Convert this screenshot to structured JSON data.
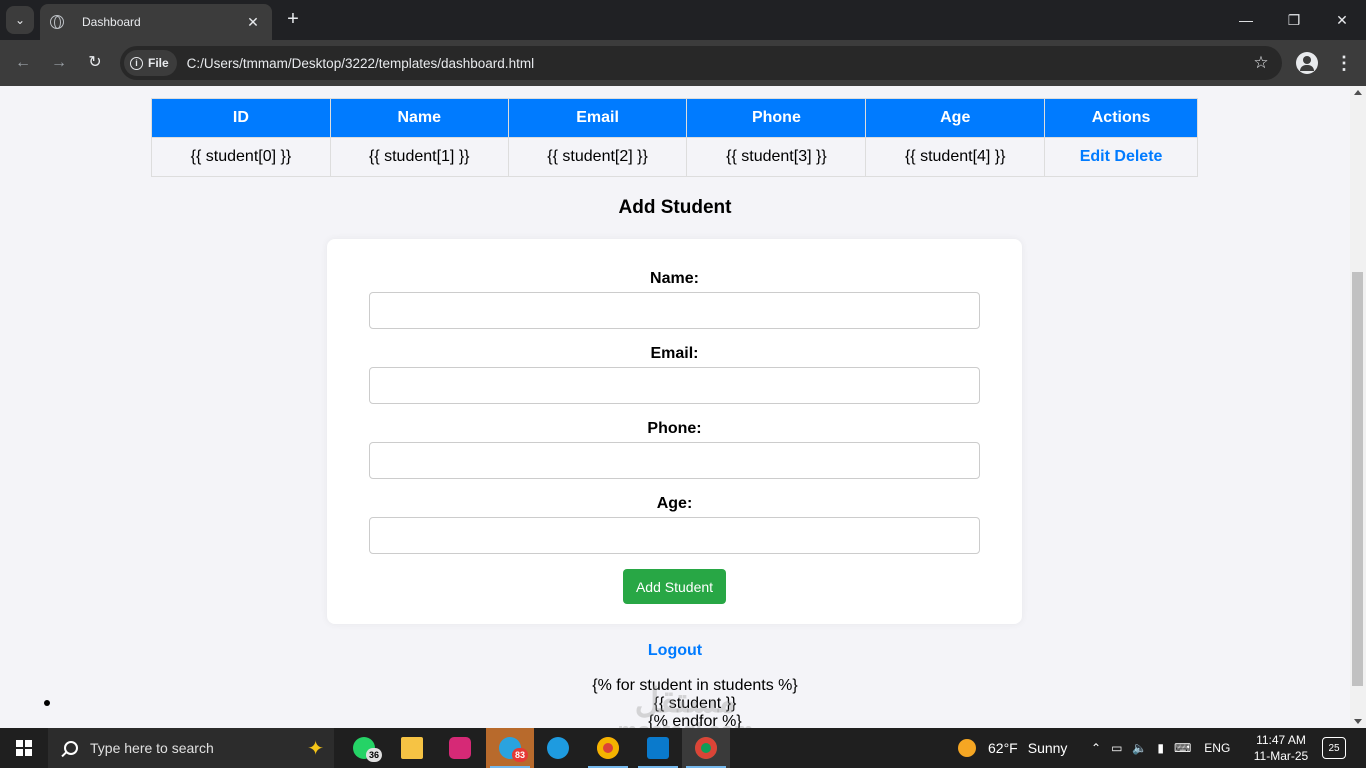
{
  "browser": {
    "tab_title": "Dashboard",
    "file_chip": "File",
    "url": "C:/Users/tmmam/Desktop/3222/templates/dashboard.html"
  },
  "table": {
    "headers": [
      "ID",
      "Name",
      "Email",
      "Phone",
      "Age",
      "Actions"
    ],
    "row": [
      "{{ student[0] }}",
      "{{ student[1] }}",
      "{{ student[2] }}",
      "{{ student[3] }}",
      "{{ student[4] }}"
    ],
    "edit_label": "Edit",
    "delete_label": "Delete"
  },
  "form": {
    "title": "Add Student",
    "name_label": "Name:",
    "email_label": "Email:",
    "phone_label": "Phone:",
    "age_label": "Age:",
    "submit_label": "Add Student"
  },
  "logout_label": "Logout",
  "template_text": {
    "line1": "{% for student in students %}",
    "line2": "{{ student }}",
    "line3": "{% endfor %}"
  },
  "watermark": {
    "arabic": "مستقل",
    "latin": "mostaql.com"
  },
  "taskbar": {
    "search_placeholder": "Type here to search",
    "whatsapp_badge": "36",
    "telegram_badge": "83",
    "weather_temp": "62°F",
    "weather_text": "Sunny",
    "language": "ENG",
    "time": "11:47 AM",
    "date": "11-Mar-25",
    "notification_count": "25"
  },
  "colors": {
    "accent_blue": "#007bff",
    "button_green": "#28a745"
  }
}
